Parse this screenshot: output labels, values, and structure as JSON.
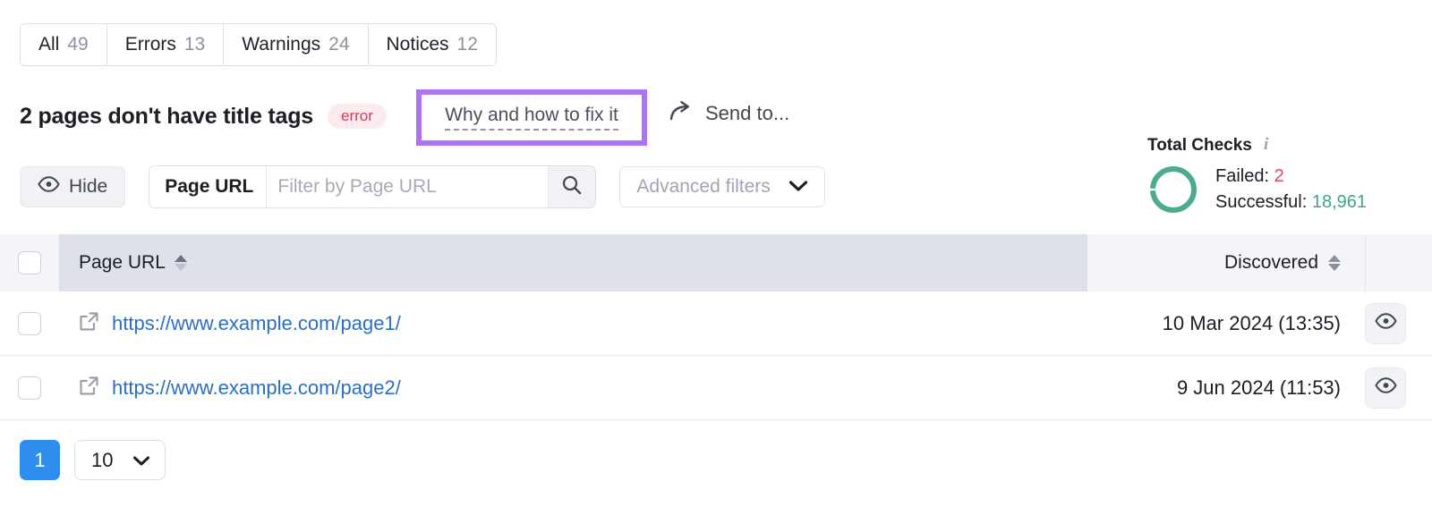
{
  "tabs": [
    {
      "label": "All",
      "count": "49",
      "name": "tab-all"
    },
    {
      "label": "Errors",
      "count": "13",
      "name": "tab-errors"
    },
    {
      "label": "Warnings",
      "count": "24",
      "name": "tab-warnings"
    },
    {
      "label": "Notices",
      "count": "12",
      "name": "tab-notices"
    }
  ],
  "issue": {
    "title": "2 pages don't have title tags",
    "badge": "error",
    "fix_link": "Why and how to fix it",
    "send_to": "Send to...",
    "highlight_color": "#ad73f3",
    "badge_bg": "#fdeaee",
    "badge_color": "#c9415b"
  },
  "filters": {
    "hide_label": "Hide",
    "search_prefix": "Page URL",
    "search_value": "",
    "search_placeholder": "Filter by Page URL",
    "advanced_label": "Advanced filters"
  },
  "total_checks": {
    "title": "Total Checks",
    "failed_label": "Failed:",
    "failed_value": "2",
    "successful_label": "Successful:",
    "successful_value": "18,961",
    "failed_color": "#e2445c",
    "successful_color": "#3aa884",
    "donut_color": "#4cab8a",
    "donut_percent_successful": 99
  },
  "table": {
    "columns": {
      "url": "Page URL",
      "discovered": "Discovered"
    },
    "rows": [
      {
        "url": "https://www.example.com/page1/",
        "discovered": "10 Mar 2024 (13:35)"
      },
      {
        "url": "https://www.example.com/page2/",
        "discovered": "9 Jun 2024 (11:53)"
      }
    ]
  },
  "pagination": {
    "current_page": "1",
    "per_page": "10"
  }
}
